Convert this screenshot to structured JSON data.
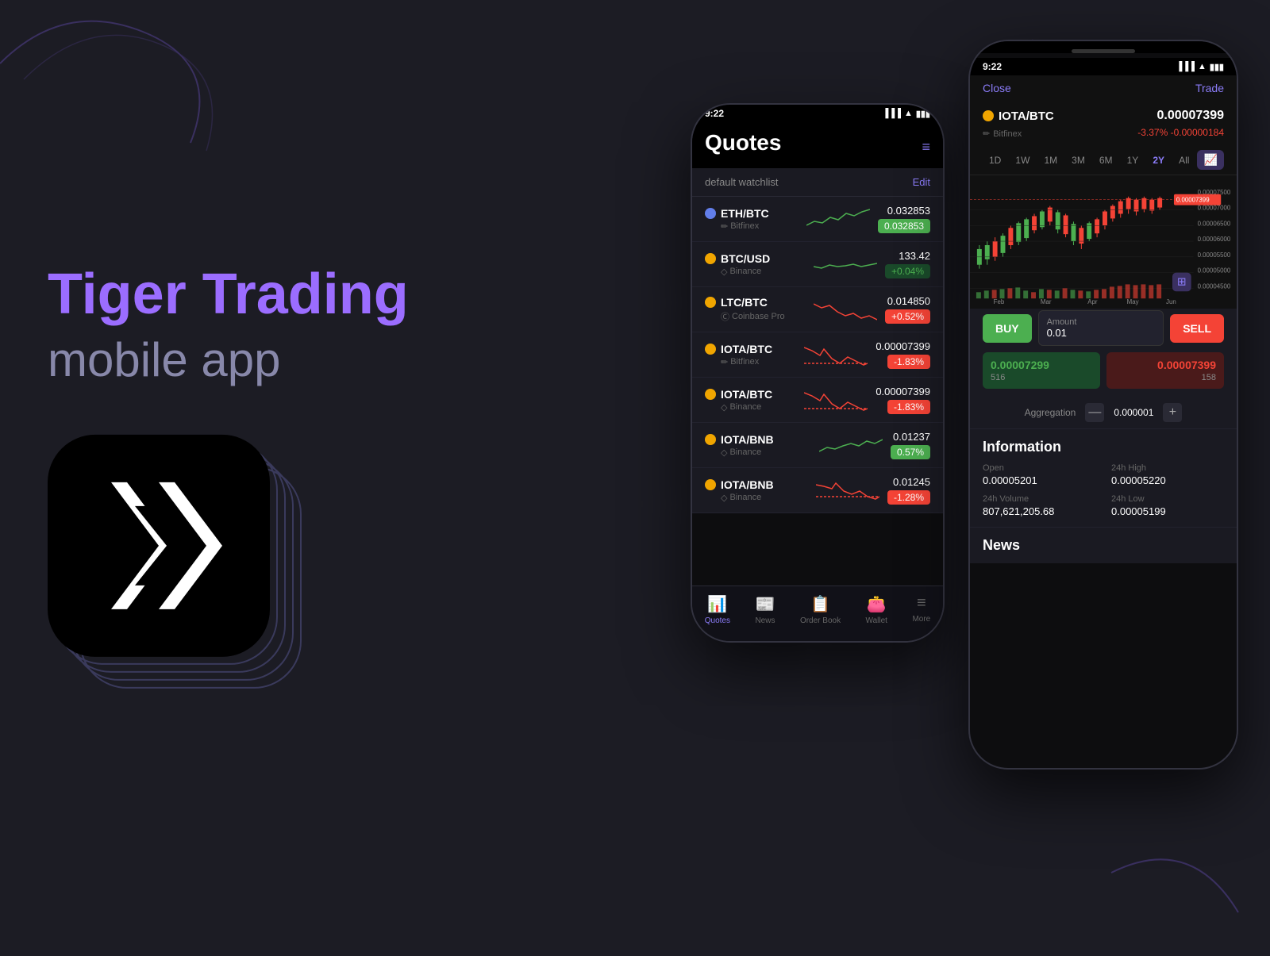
{
  "app": {
    "title": "Tiger Trading",
    "subtitle": "mobile app"
  },
  "phone1": {
    "time": "9:22",
    "screen": "Quotes",
    "watchlist_label": "default watchlist",
    "edit_label": "Edit",
    "quotes": [
      {
        "pair": "ETH/BTC",
        "exchange": "Bitfinex",
        "price": "0.032853",
        "change": "0.032853",
        "change_type": "green_solid",
        "coin_color": "eth"
      },
      {
        "pair": "BTC/USD",
        "exchange": "Binance",
        "price": "133.42",
        "change": "+0.04%",
        "change_type": "green"
      },
      {
        "pair": "LTC/BTC",
        "exchange": "Coinbase Pro",
        "price": "0.014850",
        "change": "+0.52%",
        "change_type": "red_solid"
      },
      {
        "pair": "IOTA/BTC",
        "exchange": "Bitfinex",
        "price": "0.00007399",
        "change": "-1.83%",
        "change_type": "red_solid"
      },
      {
        "pair": "IOTA/BTC",
        "exchange": "Binance",
        "price": "0.00007399",
        "change": "-1.83%",
        "change_type": "red_solid"
      },
      {
        "pair": "IOTA/BNB",
        "exchange": "Binance",
        "price": "0.01237",
        "change": "0.57%",
        "change_type": "green_solid"
      },
      {
        "pair": "IOTA/BNB",
        "exchange": "Binance",
        "price": "0.01245",
        "change": "-1.28%",
        "change_type": "red_solid"
      }
    ],
    "nav": [
      {
        "label": "Quotes",
        "active": true
      },
      {
        "label": "News",
        "active": false
      },
      {
        "label": "Order Book",
        "active": false
      },
      {
        "label": "Wallet",
        "active": false
      },
      {
        "label": "More",
        "active": false
      }
    ]
  },
  "phone2": {
    "time": "9:22",
    "close_label": "Close",
    "trade_label": "Trade",
    "pair": "IOTA/BTC",
    "exchange": "Bitfinex",
    "price": "0.00007399",
    "change_pct": "-3.37%",
    "change_abs": "-0.00000184",
    "time_periods": [
      "1D",
      "1W",
      "1M",
      "3M",
      "6M",
      "1Y",
      "2Y",
      "All"
    ],
    "active_period": "2Y",
    "buy_label": "BUY",
    "sell_label": "SELL",
    "amount_label": "Amount",
    "amount_value": "0.01",
    "bid_price": "0.00007299",
    "bid_qty": "516",
    "ask_price": "0.00007399",
    "ask_qty": "158",
    "aggregation_label": "Aggregation",
    "aggregation_minus": "—",
    "aggregation_value": "0.000001",
    "aggregation_plus": "+",
    "info_title": "Information",
    "open_label": "Open",
    "open_value": "0.00005201",
    "high_label": "24h High",
    "high_value": "0.00005220",
    "volume_label": "24h Volume",
    "volume_value": "807,621,205.68",
    "low_label": "24h Low",
    "low_value": "0.00005199",
    "news_title": "News",
    "chart_y_labels": [
      "0.00007500",
      "0.00007000",
      "0.00006500",
      "0.00006000",
      "0.00005500",
      "0.00005000",
      "0.00004500"
    ],
    "chart_x_labels": [
      "Feb",
      "Mar",
      "Apr",
      "May",
      "Jun"
    ],
    "current_price_label": "0.00007399"
  }
}
